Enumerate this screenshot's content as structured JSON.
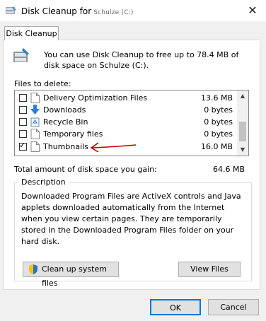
{
  "window": {
    "title": "Disk Cleanup for",
    "title_extra": "Schulze (C:)",
    "close_glyph": "✕"
  },
  "tab": {
    "label": "Disk Cleanup"
  },
  "intro": {
    "text": "You can use Disk Cleanup to free up to 78.4 MB of disk space on Schulze (C:)."
  },
  "files": {
    "label": "Files to delete:",
    "items": [
      {
        "name": "Delivery Optimization Files",
        "size": "13.6 MB",
        "checked": false,
        "icon": "document-icon"
      },
      {
        "name": "Downloads",
        "size": "0 bytes",
        "checked": false,
        "icon": "download-arrow-icon"
      },
      {
        "name": "Recycle Bin",
        "size": "0 bytes",
        "checked": false,
        "icon": "recycle-bin-icon"
      },
      {
        "name": "Temporary files",
        "size": "0 bytes",
        "checked": false,
        "icon": "document-icon"
      },
      {
        "name": "Thumbnails",
        "size": "16.0 MB",
        "checked": true,
        "icon": "document-icon"
      }
    ]
  },
  "total": {
    "label": "Total amount of disk space you gain:",
    "value": "64.6 MB"
  },
  "description": {
    "legend": "Description",
    "text": "Downloaded Program Files are ActiveX controls and Java applets downloaded automatically from the Internet when you view certain pages. They are temporarily stored in the Downloaded Program Files folder on your hard disk."
  },
  "buttons": {
    "cleanup_system": "Clean up system files",
    "view_files": "View Files",
    "ok": "OK",
    "cancel": "Cancel"
  },
  "colors": {
    "accent": "#0078d7",
    "annotation": "#c00000",
    "download_arrow": "#2f7fd6"
  }
}
